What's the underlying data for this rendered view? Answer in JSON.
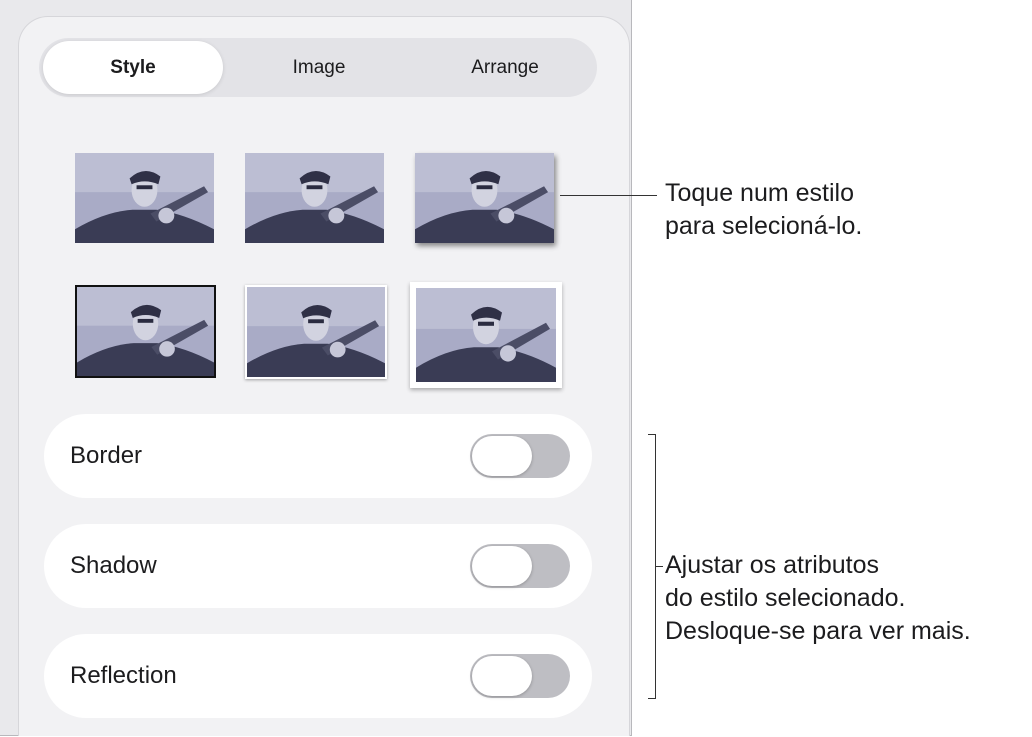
{
  "tabs": [
    {
      "label": "Style",
      "active": true
    },
    {
      "label": "Image",
      "active": false
    },
    {
      "label": "Arrange",
      "active": false
    }
  ],
  "style_thumbnails": [
    "plain",
    "reflection",
    "drop-shadow",
    "black-border",
    "white-border-shadow",
    "photo-frame-curl"
  ],
  "toggles": [
    {
      "label": "Border",
      "on": false
    },
    {
      "label": "Shadow",
      "on": false
    },
    {
      "label": "Reflection",
      "on": false
    }
  ],
  "callouts": {
    "styles": [
      "Toque num estilo",
      "para selecioná-lo."
    ],
    "attributes": [
      "Ajustar os atributos",
      "do estilo selecionado.",
      "Desloque-se para ver mais."
    ]
  },
  "colors": {
    "panel_bg": "#f2f2f4",
    "segment_bg": "#e3e3e7",
    "toggle_off": "#bebec3",
    "photo_tint": "#8e90b0"
  }
}
